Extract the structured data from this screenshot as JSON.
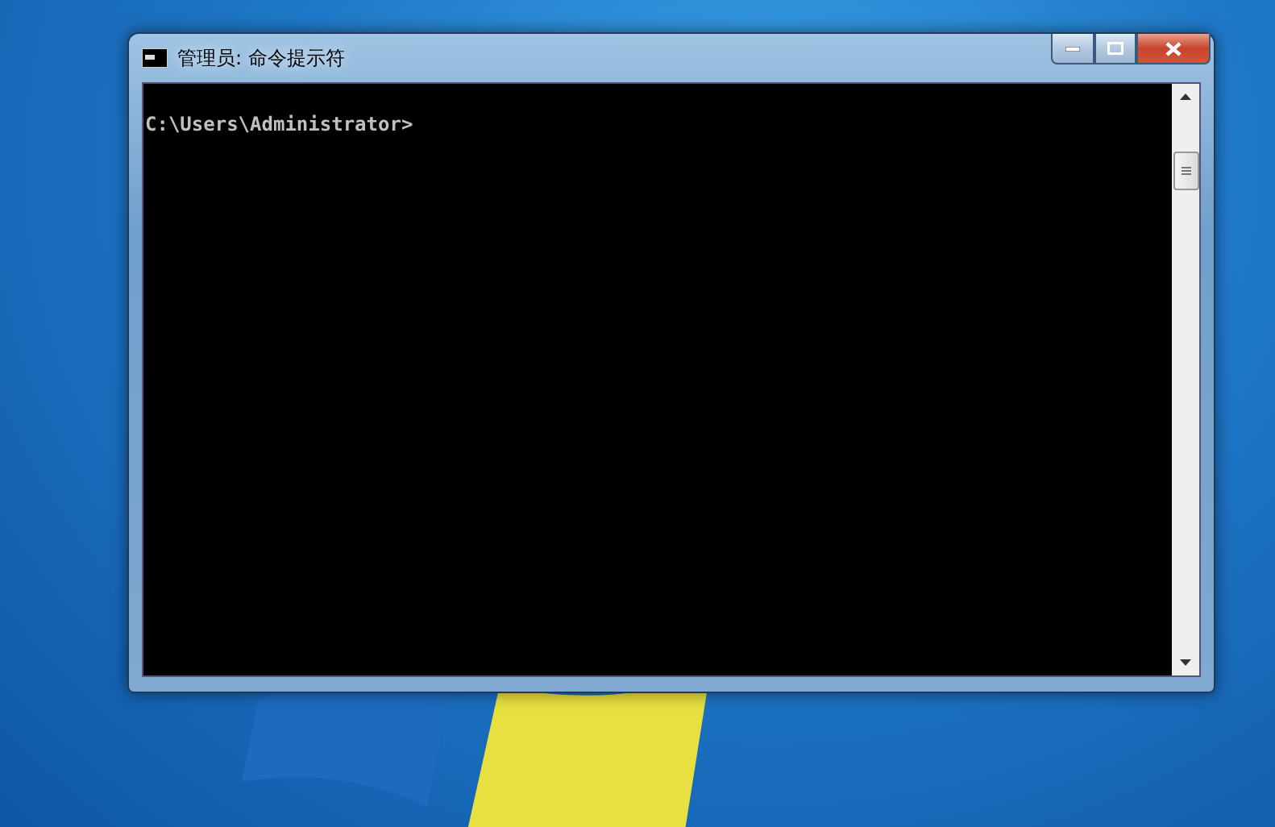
{
  "window": {
    "title": "管理员: 命令提示符"
  },
  "console": {
    "lines": [
      "C:\\Users\\Administrator>"
    ]
  }
}
